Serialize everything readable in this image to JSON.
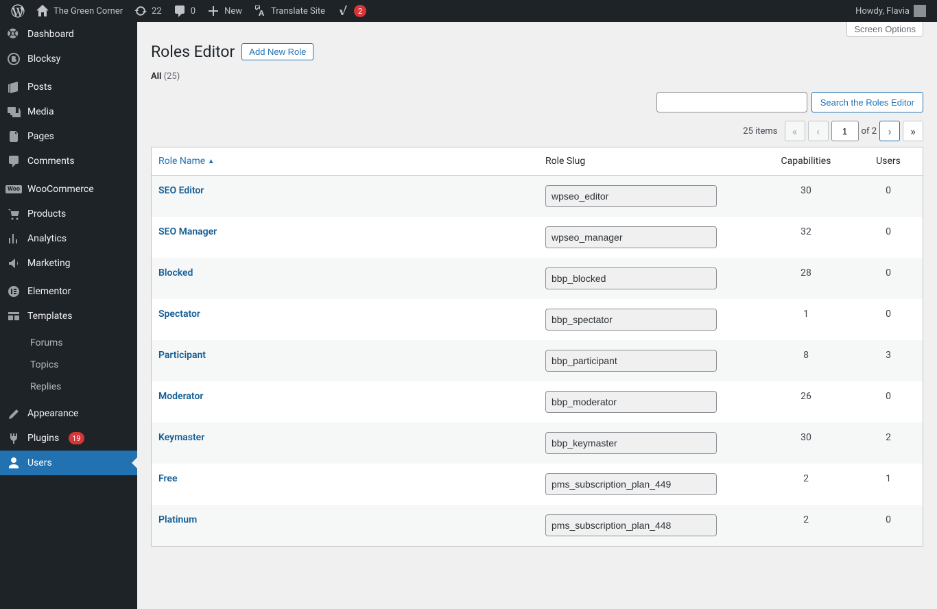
{
  "adminbar": {
    "site_name": "The Green Corner",
    "updates": "22",
    "comments": "0",
    "new": "New",
    "translate": "Translate Site",
    "yoast_badge": "2",
    "howdy": "Howdy, Flavia"
  },
  "sidebar": [
    {
      "icon": "dashboard",
      "label": "Dashboard"
    },
    {
      "icon": "blocksy",
      "label": "Blocksy"
    },
    {
      "sep": true
    },
    {
      "icon": "posts",
      "label": "Posts"
    },
    {
      "icon": "media",
      "label": "Media"
    },
    {
      "icon": "pages",
      "label": "Pages"
    },
    {
      "icon": "comments",
      "label": "Comments"
    },
    {
      "sep": true
    },
    {
      "icon": "woo",
      "label": "WooCommerce"
    },
    {
      "icon": "products",
      "label": "Products"
    },
    {
      "icon": "analytics",
      "label": "Analytics"
    },
    {
      "icon": "marketing",
      "label": "Marketing"
    },
    {
      "sep": true
    },
    {
      "icon": "elementor",
      "label": "Elementor"
    },
    {
      "icon": "templates",
      "label": "Templates"
    },
    {
      "sep": true
    },
    {
      "sub": true,
      "label": "Forums"
    },
    {
      "sub": true,
      "label": "Topics"
    },
    {
      "sub": true,
      "label": "Replies"
    },
    {
      "sep": true
    },
    {
      "icon": "appearance",
      "label": "Appearance"
    },
    {
      "icon": "plugins",
      "label": "Plugins",
      "badge": "19"
    },
    {
      "icon": "users",
      "label": "Users",
      "current": true
    }
  ],
  "page": {
    "screen_options": "Screen Options",
    "title": "Roles Editor",
    "add_new": "Add New Role",
    "filter_all": "All",
    "filter_count": "(25)",
    "search_placeholder": "",
    "search_button": "Search the Roles Editor",
    "items_label": "25 items",
    "current_page": "1",
    "page_of": "of 2"
  },
  "columns": {
    "name": "Role Name",
    "slug": "Role Slug",
    "caps": "Capabilities",
    "users": "Users"
  },
  "rows": [
    {
      "name": "SEO Editor",
      "slug": "wpseo_editor",
      "caps": "30",
      "users": "0"
    },
    {
      "name": "SEO Manager",
      "slug": "wpseo_manager",
      "caps": "32",
      "users": "0"
    },
    {
      "name": "Blocked",
      "slug": "bbp_blocked",
      "caps": "28",
      "users": "0"
    },
    {
      "name": "Spectator",
      "slug": "bbp_spectator",
      "caps": "1",
      "users": "0"
    },
    {
      "name": "Participant",
      "slug": "bbp_participant",
      "caps": "8",
      "users": "3"
    },
    {
      "name": "Moderator",
      "slug": "bbp_moderator",
      "caps": "26",
      "users": "0"
    },
    {
      "name": "Keymaster",
      "slug": "bbp_keymaster",
      "caps": "30",
      "users": "2"
    },
    {
      "name": "Free",
      "slug": "pms_subscription_plan_449",
      "caps": "2",
      "users": "1"
    },
    {
      "name": "Platinum",
      "slug": "pms_subscription_plan_448",
      "caps": "2",
      "users": "0"
    }
  ]
}
